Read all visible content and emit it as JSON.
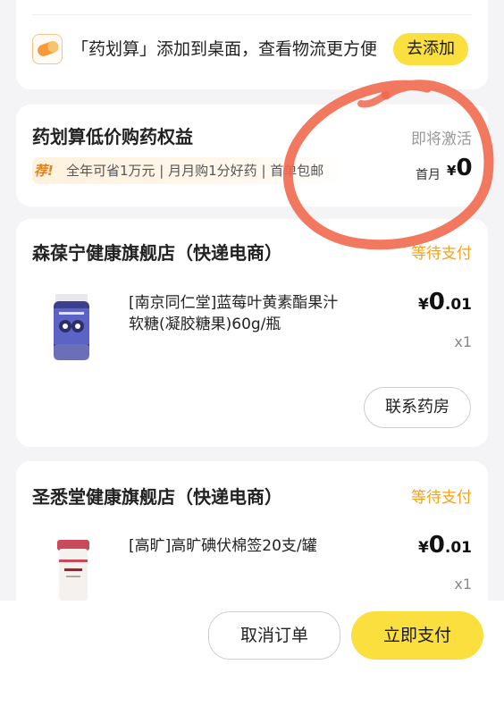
{
  "promo": {
    "text": "「药划算」添加到桌面，查看物流更方便",
    "button_label": "去添加"
  },
  "benefit": {
    "title": "药划算低价购药权益",
    "status": "即将激活",
    "tag": "荐!",
    "tagline": "全年可省1万元 | 月月购1分好药 | 首单包邮",
    "price_label": "首月",
    "currency": "¥",
    "price": "0"
  },
  "stores": [
    {
      "name": "森葆宁健康旗舰店（快递电商）",
      "status": "等待支付",
      "product": {
        "name": "[南京同仁堂]蓝莓叶黄素酯果汁软糖(凝胶糖果)60g/瓶",
        "currency": "¥",
        "price_int": "0",
        "price_dec": ".01",
        "qty": "x1"
      },
      "contact_label": "联系药房"
    },
    {
      "name": "圣悉堂健康旗舰店（快递电商）",
      "status": "等待支付",
      "product": {
        "name": "[高旷]高旷碘伏棉签20支/罐",
        "currency": "¥",
        "price_int": "0",
        "price_dec": ".01",
        "qty": "x1"
      }
    }
  ],
  "actions": {
    "cancel_label": "取消订单",
    "pay_label": "立即支付"
  },
  "colors": {
    "accent_yellow": "#fadf3e",
    "status_orange": "#f2a21b",
    "annotation_red": "#f2694f"
  }
}
